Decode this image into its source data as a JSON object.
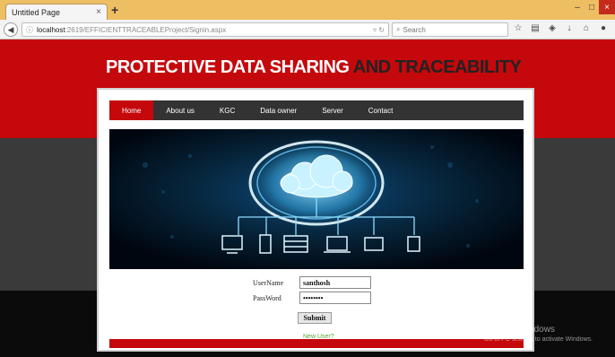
{
  "browser": {
    "tab_title": "Untitled Page",
    "tab_close": "×",
    "new_tab": "+",
    "url_host": "localhost",
    "url_path": ":2619/EFFICIENTTRACEABLEProject/Signin.aspx",
    "search_placeholder": "Search",
    "window_minimize": "–",
    "window_maximize": "□",
    "window_close": "×"
  },
  "site": {
    "title_part1": "PROTECTIVE DATA SHARING ",
    "title_part2": "AND TRACEABILITY",
    "accent_color": "#c5080c",
    "nav": [
      "Home",
      "About us",
      "KGC",
      "Data owner",
      "Server",
      "Contact"
    ],
    "active_nav": "Home"
  },
  "login": {
    "username_label": "UserName",
    "username_value": "santhosh",
    "password_label": "PassWord",
    "password_value": "password",
    "submit_label": "Submit",
    "new_user_link": "New User?"
  },
  "watermark": {
    "title": "Activate Windows",
    "subtitle": "Go to PC settings to activate Windows."
  }
}
